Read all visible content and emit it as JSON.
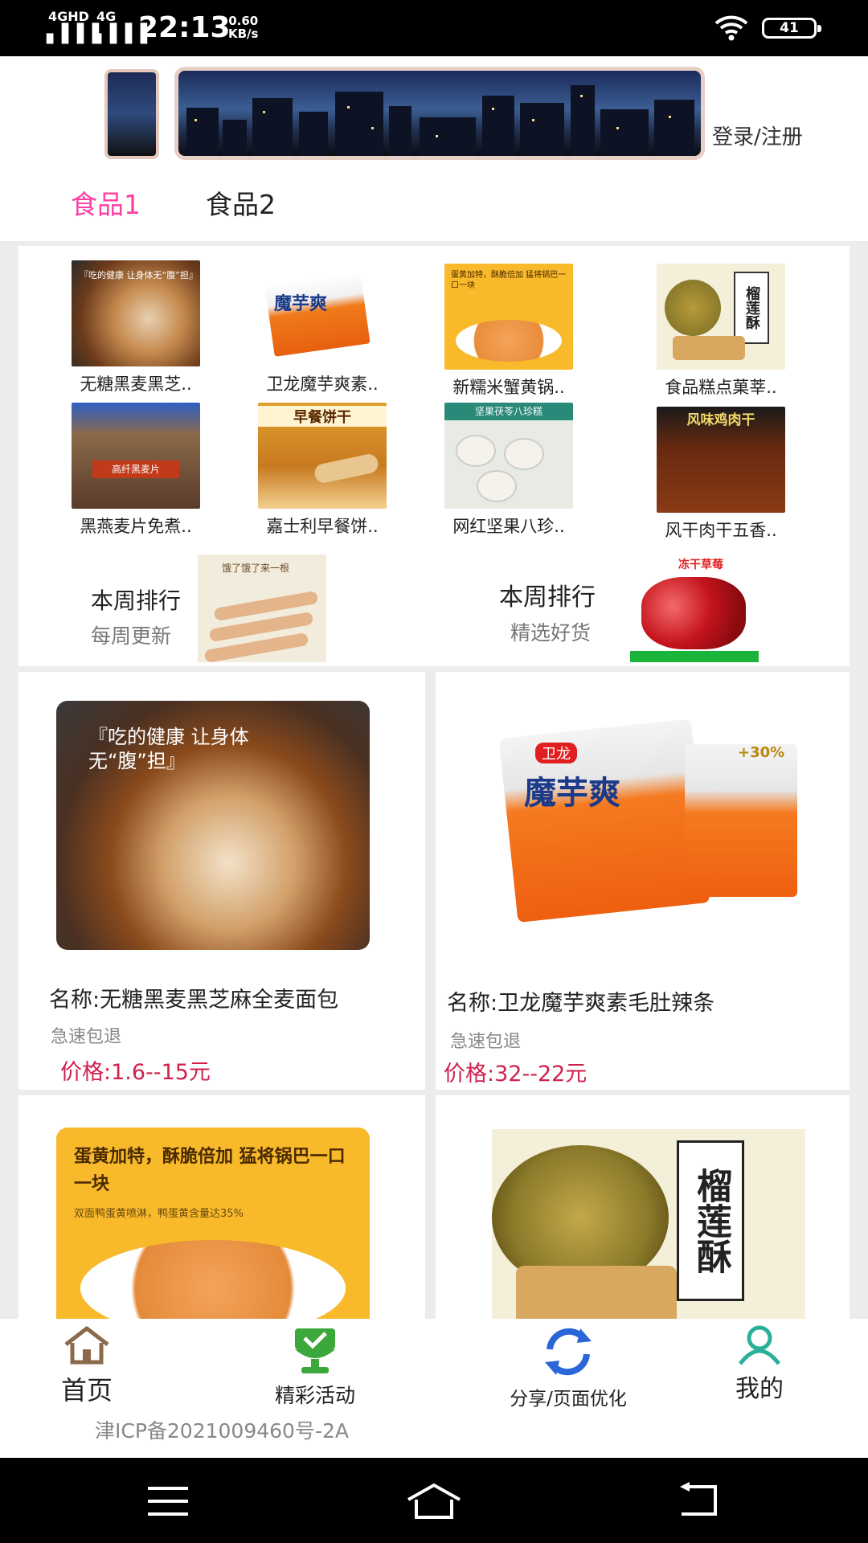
{
  "status_bar": {
    "network1": "4GHD",
    "network2": "4G",
    "time": "22:13",
    "speed_value": "0.60",
    "speed_unit": "KB/s",
    "battery": "41"
  },
  "header": {
    "login_label": "登录/注册",
    "tabs": [
      "食品1",
      "食品2"
    ],
    "active_tab": "食品1",
    "accent_color": "#ff3fa4"
  },
  "category_grid": [
    {
      "name": "无糖黑麦黑芝.."
    },
    {
      "name": "卫龙魔芋爽素.."
    },
    {
      "name": "新糯米蟹黄锅.."
    },
    {
      "name": "食品糕点菓莘.."
    },
    {
      "name": "黑燕麦片免煮.."
    },
    {
      "name": "嘉士利早餐饼.."
    },
    {
      "name": "网红坚果八珍.."
    },
    {
      "name": "风干肉干五香.."
    }
  ],
  "image_text": {
    "bread": "『吃的健康 让身体无“腹”担』",
    "konjac_brand": "卫龙",
    "konjac_name": "魔芋爽",
    "konjac_badge": "+30%",
    "guoba": "蛋黄加特，酥脆倍加 猛将锅巴一口一块",
    "guoba_sub": "双面鸭蛋黄喷淋，鸭蛋黄含量达35%",
    "durian": "榴莲酥",
    "oat": "高纤黑麦片",
    "biscuit": "早餐饼干",
    "nut": "坚果茯苓八珍糕",
    "jerky": "风味鸡肉干",
    "strawberry": "冻干草莓",
    "rank1_img": "饿了饿了来一根"
  },
  "weekly_rank": [
    {
      "title": "本周排行",
      "subtitle": "每周更新"
    },
    {
      "title": "本周排行",
      "subtitle": "精选好货"
    }
  ],
  "products": [
    {
      "name": "名称:无糖黑麦黑芝麻全麦面包",
      "shipping": "急速包退",
      "price": "价格:1.6--15元"
    },
    {
      "name": "名称:卫龙魔芋爽素毛肚辣条",
      "shipping": "急速包退",
      "price": "价格:32--22元"
    },
    {
      "name": "",
      "shipping": "",
      "price": ""
    },
    {
      "name": "",
      "shipping": "",
      "price": ""
    }
  ],
  "bottom_nav": [
    {
      "label": "首页"
    },
    {
      "label": "精彩活动"
    },
    {
      "label": "分享/页面优化"
    },
    {
      "label": "我的"
    }
  ],
  "icp": "津ICP备2021009460号-2A"
}
